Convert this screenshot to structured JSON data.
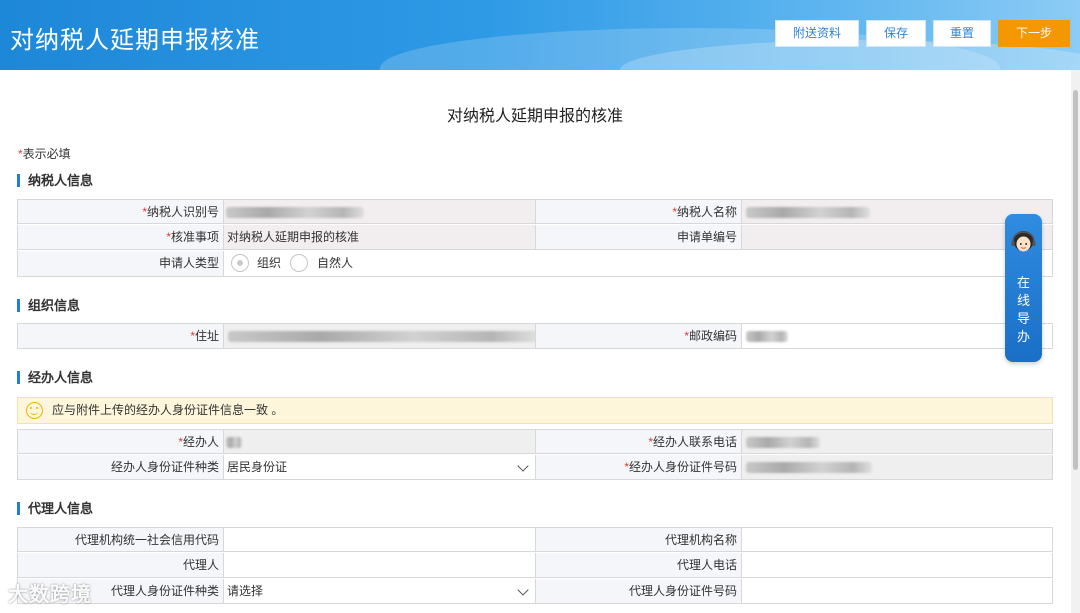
{
  "header": {
    "title": "对纳税人延期申报核准",
    "buttons": {
      "attach": "附送资料",
      "save": "保存",
      "reset": "重置",
      "next": "下一步"
    }
  },
  "page": {
    "title": "对纳税人延期申报的核准",
    "required_note": "表示必填",
    "required_mark": "*"
  },
  "sections": {
    "taxpayer": {
      "title": "纳税人信息",
      "id_label": "纳税人识别号",
      "name_label": "纳税人名称",
      "item_label": "核准事项",
      "item_value": "对纳税人延期申报的核准",
      "app_no_label": "申请单编号",
      "applicant_type_label": "申请人类型",
      "applicant_type_options": [
        "组织",
        "自然人"
      ]
    },
    "organization": {
      "title": "组织信息",
      "address_label": "住址",
      "postcode_label": "邮政编码"
    },
    "handler": {
      "title": "经办人信息",
      "notice": "应与附件上传的经办人身份证件信息一致 。",
      "handler_label": "经办人",
      "phone_label": "经办人联系电话",
      "id_type_label": "经办人身份证件种类",
      "id_type_value": "居民身份证",
      "id_no_label": "经办人身份证件号码"
    },
    "agent": {
      "title": "代理人信息",
      "org_code_label": "代理机构统一社会信用代码",
      "org_name_label": "代理机构名称",
      "agent_label": "代理人",
      "agent_phone_label": "代理人电话",
      "agent_id_type_label": "代理人身份证件种类",
      "agent_id_type_value": "请选择",
      "agent_id_no_label": "代理人身份证件号码"
    }
  },
  "guide": {
    "label": "在线导办",
    "chars": [
      "在",
      "线",
      "导",
      "办"
    ]
  },
  "watermark": "大数跨境"
}
